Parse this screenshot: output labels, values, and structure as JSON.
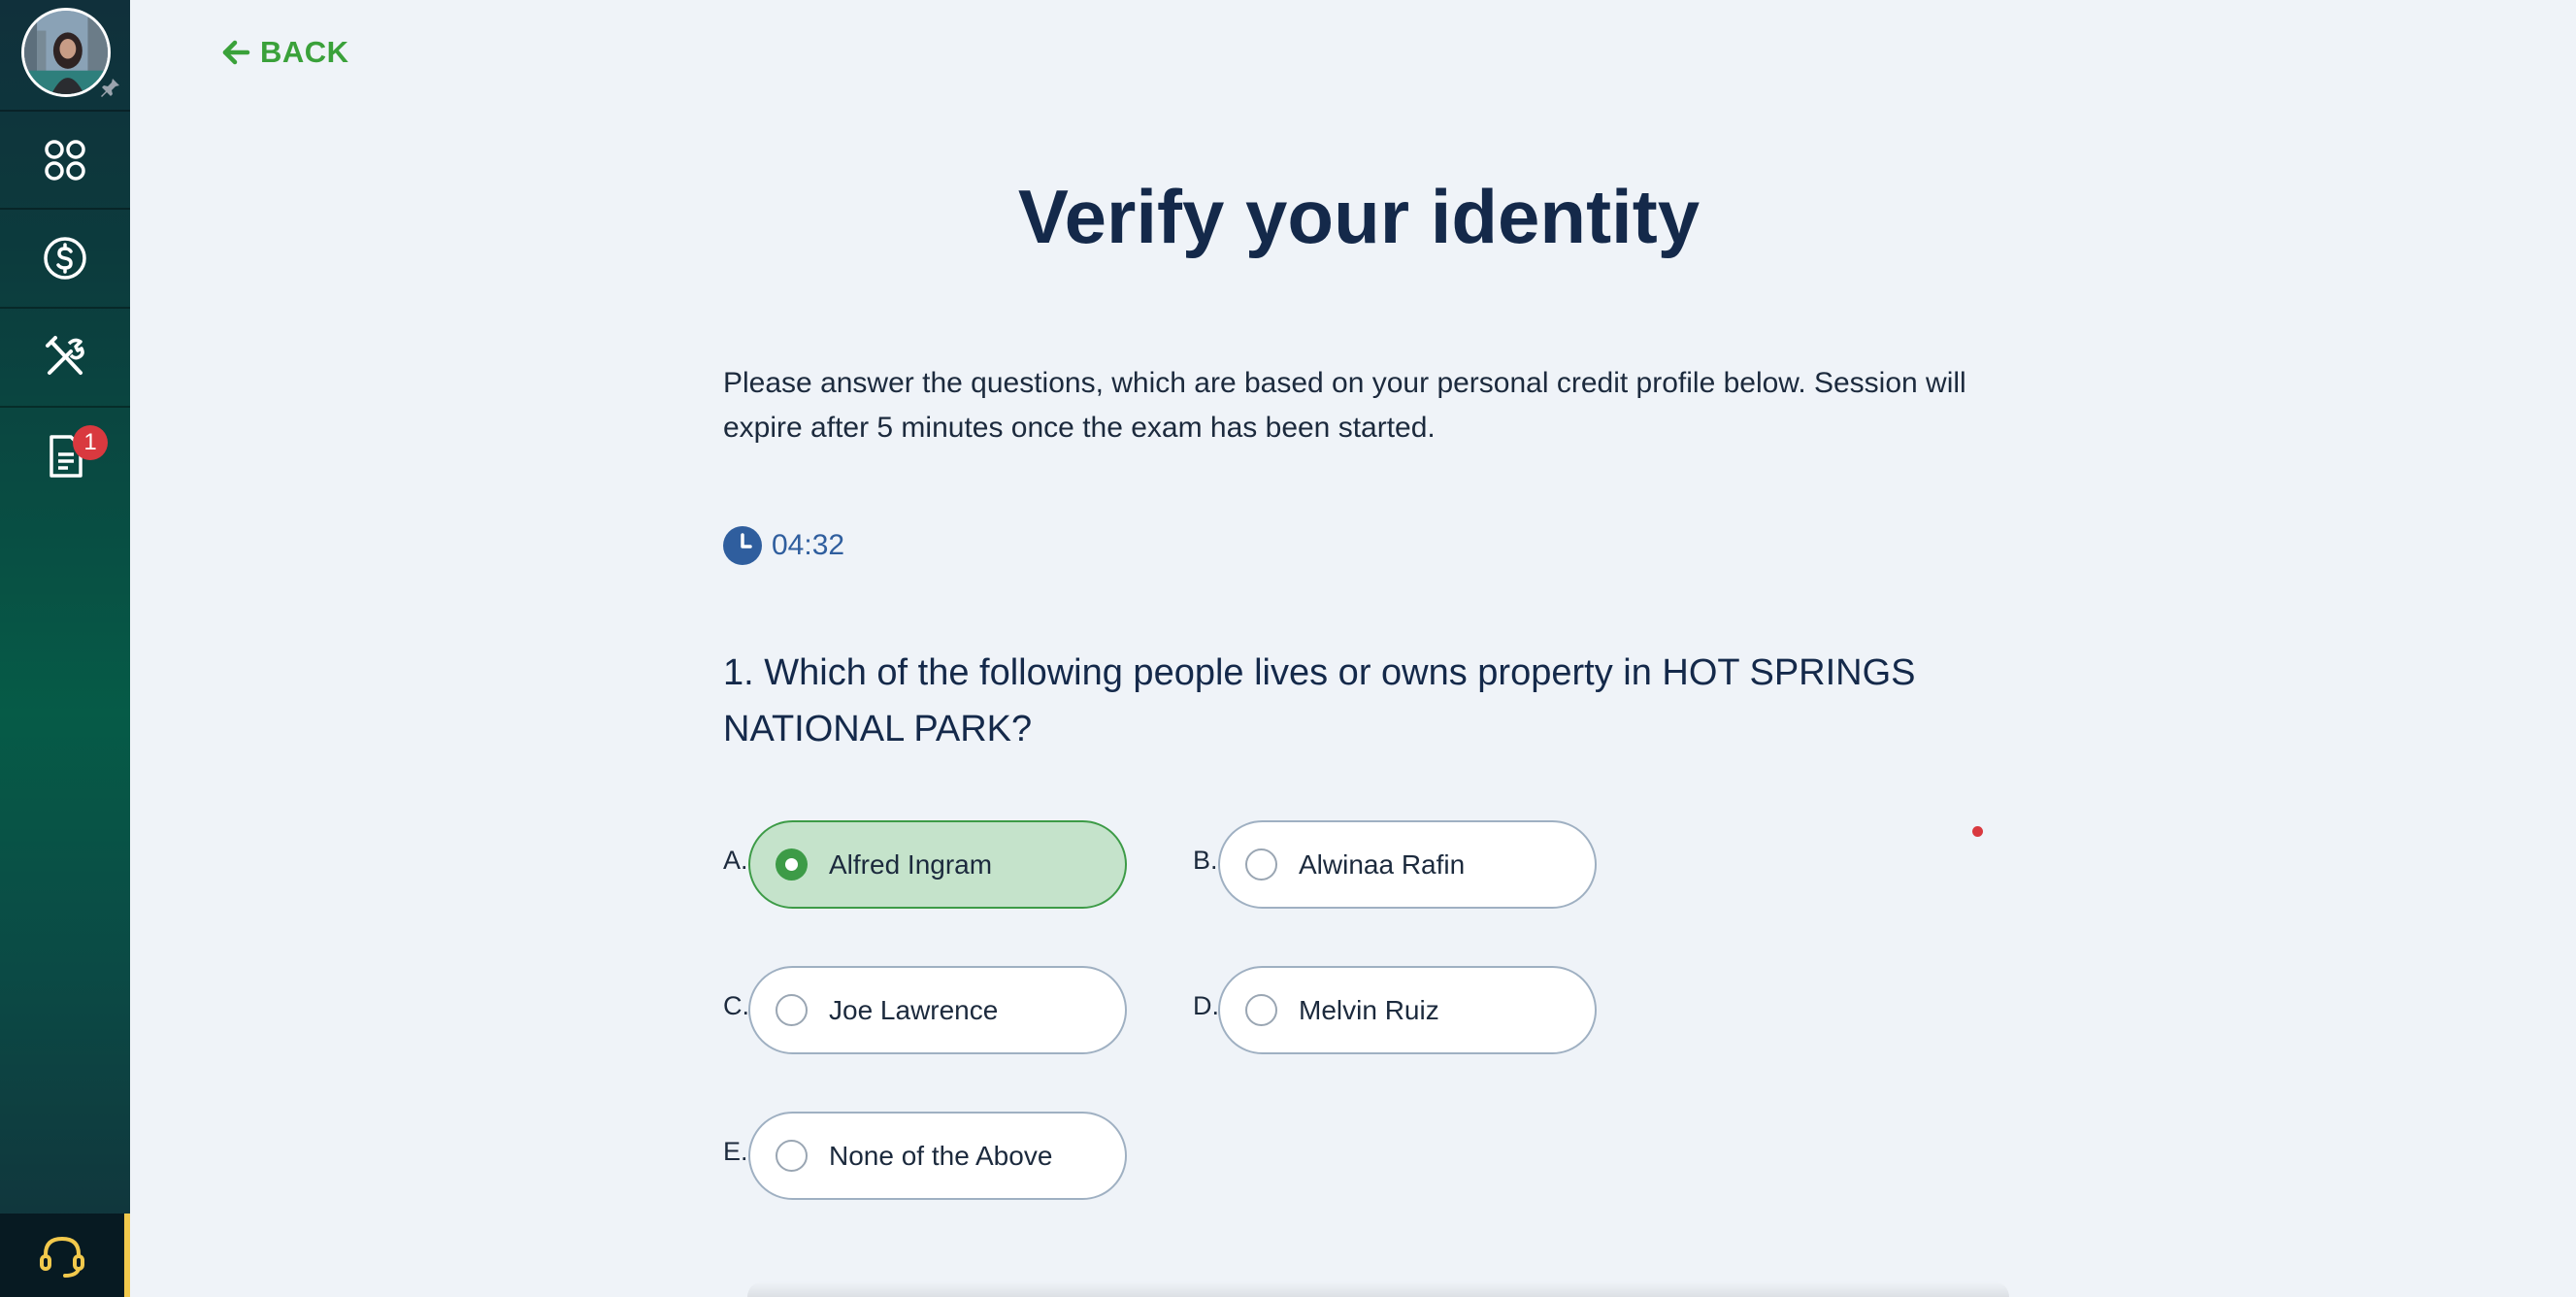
{
  "sidebar": {
    "avatar_alt": "User profile photo",
    "nav": [
      {
        "name": "dashboard",
        "icon": "grid-icon"
      },
      {
        "name": "finance",
        "icon": "dollar-circle-icon"
      },
      {
        "name": "tools",
        "icon": "tools-icon"
      },
      {
        "name": "documents",
        "icon": "document-icon",
        "badge": "1"
      }
    ],
    "support_icon": "headset-icon"
  },
  "header": {
    "back_label": "BACK"
  },
  "main": {
    "title": "Verify your identity",
    "intro": "Please answer the questions, which are based on your personal credit profile below. Session will expire after 5 minutes once the exam has been started.",
    "timer": "04:32",
    "question": "1. Which of the following people lives or owns property in HOT SPRINGS NATIONAL PARK?",
    "options": [
      {
        "letter": "A.",
        "label": "Alfred Ingram",
        "selected": true
      },
      {
        "letter": "B.",
        "label": "Alwinaa Rafin",
        "selected": false
      },
      {
        "letter": "C.",
        "label": "Joe Lawrence",
        "selected": false
      },
      {
        "letter": "D.",
        "label": "Melvin Ruiz",
        "selected": false
      },
      {
        "letter": "E.",
        "label": "None of the Above",
        "selected": false
      }
    ]
  },
  "colors": {
    "accent_green": "#3aa13a",
    "selected_fill": "#c5e3cb",
    "title_navy": "#14294a",
    "badge_red": "#d9393f",
    "support_yellow": "#f2c94c"
  }
}
